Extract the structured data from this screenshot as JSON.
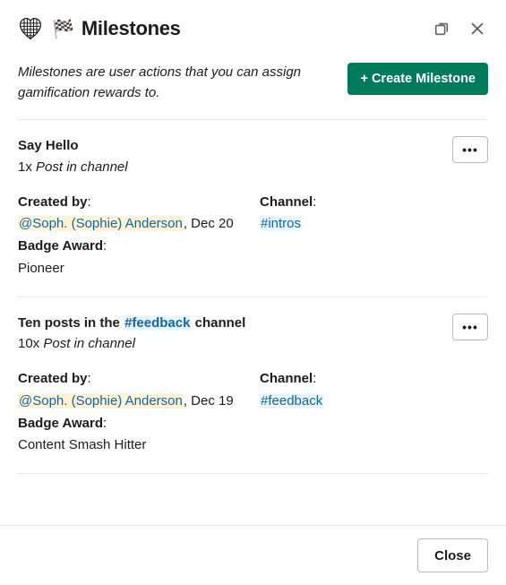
{
  "header": {
    "emoji": "🏁",
    "title": "Milestones"
  },
  "intro": "Milestones are user actions that you can assign gamification rewards to.",
  "buttons": {
    "create": "+ Create Milestone",
    "close": "Close"
  },
  "labels": {
    "created_by": "Created by",
    "channel": "Channel",
    "badge_award": "Badge Award"
  },
  "milestones": [
    {
      "title_prefix": "Say Hello",
      "title_channel": "",
      "title_suffix": "",
      "count": "1x",
      "desc": "Post in channel",
      "creator": "@Soph. (Sophie) Anderson",
      "date": "Dec 20",
      "channel": "#intros",
      "badge": "Pioneer"
    },
    {
      "title_prefix": "Ten posts in the ",
      "title_channel": "#feedback",
      "title_suffix": " channel",
      "count": "10x",
      "desc": "Post in channel",
      "creator": "@Soph. (Sophie) Anderson",
      "date": "Dec 19",
      "channel": "#feedback",
      "badge": "Content Smash Hitter"
    }
  ]
}
